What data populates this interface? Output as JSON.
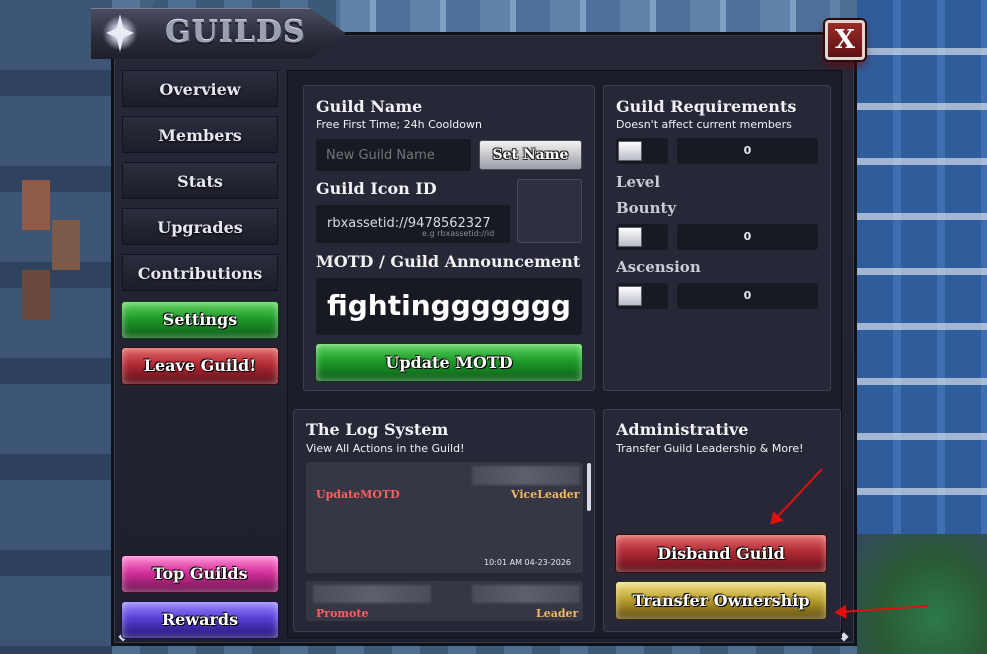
{
  "window": {
    "title": "GUILDS",
    "close_label": "X"
  },
  "sidebar": {
    "items": [
      {
        "label": "Overview"
      },
      {
        "label": "Members"
      },
      {
        "label": "Stats"
      },
      {
        "label": "Upgrades"
      },
      {
        "label": "Contributions"
      }
    ],
    "settings_label": "Settings",
    "leave_label": "Leave Guild!",
    "top_guilds_label": "Top Guilds",
    "rewards_label": "Rewards"
  },
  "guild_name": {
    "heading": "Guild Name",
    "subtitle": "Free First Time; 24h Cooldown",
    "placeholder": "New Guild Name",
    "set_button": "Set Name"
  },
  "guild_icon": {
    "heading": "Guild Icon ID",
    "value": "rbxassetid://9478562327",
    "hint": "e.g rbxassetid://id"
  },
  "motd": {
    "heading": "MOTD / Guild Announcement",
    "value": "fightinggggggg",
    "update_button": "Update MOTD"
  },
  "requirements": {
    "heading": "Guild Requirements",
    "subtitle": "Doesn't affect current members",
    "first_value": "0",
    "level_label": "Level",
    "bounty_label": "Bounty",
    "bounty_value": "0",
    "ascension_label": "Ascension",
    "ascension_value": "0"
  },
  "log": {
    "heading": "The Log System",
    "subtitle": "View All Actions in the Guild!",
    "entries": [
      {
        "action": "UpdateMOTD",
        "role": "ViceLeader",
        "time": "10:01 AM  04-23-2026"
      },
      {
        "action": "Promote",
        "role": "Leader"
      }
    ]
  },
  "admin": {
    "heading": "Administrative",
    "subtitle": "Transfer Guild Leadership & More!",
    "disband_button": "Disband Guild",
    "transfer_button": "Transfer Ownership"
  },
  "colors": {
    "panel": "#262837",
    "accent_green": "#1f9c2b",
    "accent_red": "#b32a35",
    "log_action": "#ff5f5f",
    "log_role": "#f3b766",
    "annotation_arrow": "#e01010"
  }
}
